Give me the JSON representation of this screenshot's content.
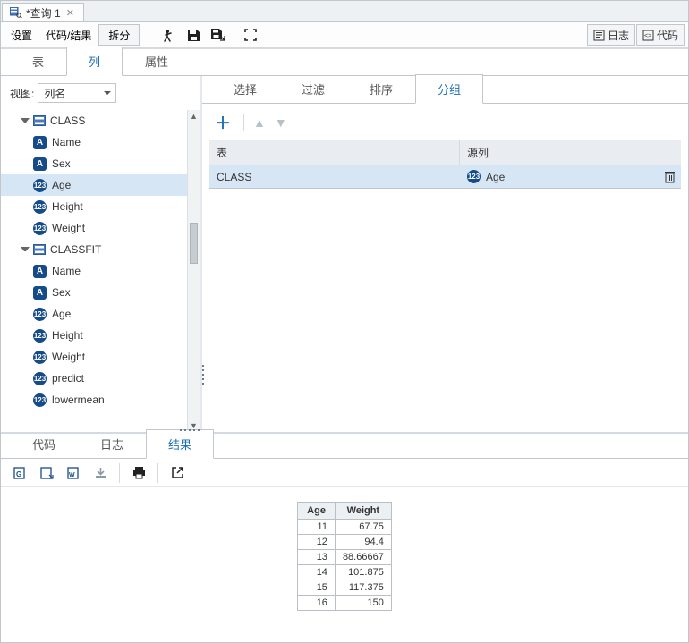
{
  "window": {
    "tab_title": "*查询 1"
  },
  "toolbar": {
    "settings": "设置",
    "code_result": "代码/结果",
    "split": "拆分",
    "log_btn": "日志",
    "code_btn": "代码"
  },
  "top_tabs": {
    "table": "表",
    "columns": "列",
    "attributes": "属性"
  },
  "sidebar": {
    "view_label": "视图:",
    "view_value": "列名",
    "tables": [
      {
        "name": "CLASS",
        "cols": [
          {
            "name": "Name",
            "type": "A"
          },
          {
            "name": "Sex",
            "type": "A"
          },
          {
            "name": "Age",
            "type": "N",
            "selected": true
          },
          {
            "name": "Height",
            "type": "N"
          },
          {
            "name": "Weight",
            "type": "N"
          }
        ]
      },
      {
        "name": "CLASSFIT",
        "cols": [
          {
            "name": "Name",
            "type": "A"
          },
          {
            "name": "Sex",
            "type": "A"
          },
          {
            "name": "Age",
            "type": "N"
          },
          {
            "name": "Height",
            "type": "N"
          },
          {
            "name": "Weight",
            "type": "N"
          },
          {
            "name": "predict",
            "type": "N"
          },
          {
            "name": "lowermean",
            "type": "N"
          }
        ]
      }
    ]
  },
  "subtabs": {
    "select": "选择",
    "filter": "过滤",
    "sort": "排序",
    "group": "分组"
  },
  "grid": {
    "head_table": "表",
    "head_source": "源列",
    "rows": [
      {
        "table": "CLASS",
        "col": "Age"
      }
    ]
  },
  "bottom_tabs": {
    "code": "代码",
    "log": "日志",
    "result": "结果"
  },
  "result_table": {
    "cols": [
      "Age",
      "Weight"
    ],
    "rows": [
      [
        "11",
        "67.75"
      ],
      [
        "12",
        "94.4"
      ],
      [
        "13",
        "88.66667"
      ],
      [
        "14",
        "101.875"
      ],
      [
        "15",
        "117.375"
      ],
      [
        "16",
        "150"
      ]
    ]
  }
}
